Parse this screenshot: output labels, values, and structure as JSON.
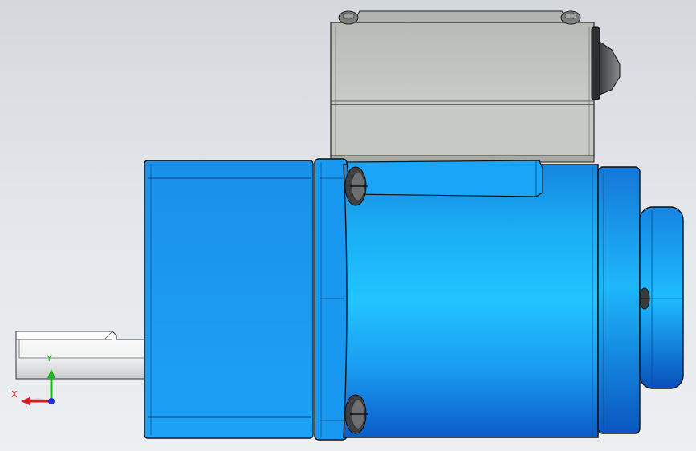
{
  "scene": {
    "background_top": "#d4d8dd",
    "background_bottom": "#edeff1",
    "model_color": "#1a9bf0",
    "model_highlight": "#22c4ff",
    "gearbox_color": "#c4c6c2",
    "shaft_color": "#f2f3f4"
  },
  "triad": {
    "x_label": "X",
    "y_label": "Y",
    "x_color": "#d81b1b",
    "y_color": "#1fb51f",
    "z_color": "#1b2fe0",
    "x_icon": "x-axis-arrow-icon",
    "y_icon": "y-axis-arrow-icon",
    "origin_icon": "z-axis-origin-icon"
  }
}
